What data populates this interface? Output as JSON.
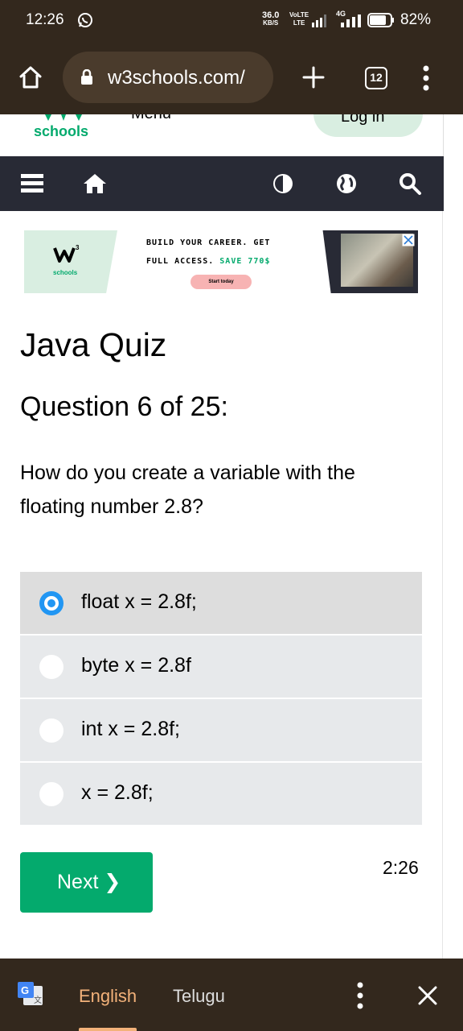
{
  "status_bar": {
    "time": "12:26",
    "speed_value": "36.0",
    "speed_unit": "KB/S",
    "volte_top": "VoLTE",
    "volte_bottom": "LTE",
    "network": "4G",
    "battery": "82%"
  },
  "browser": {
    "url": "w3schools.com/",
    "tab_count": "12"
  },
  "site": {
    "logo_word": "schools",
    "menu_label": "Menu",
    "login_label": "Log in"
  },
  "ad": {
    "logo_word": "schools",
    "line1": "BUILD YOUR CAREER. GET",
    "line2_prefix": "FULL ACCESS. ",
    "line2_save": "SAVE 770$",
    "button": "Start today"
  },
  "quiz": {
    "title": "Java Quiz",
    "question_number": "Question 6 of 25:",
    "question_text": "How do you create a variable with the floating number 2.8?",
    "options": [
      {
        "label": "float x = 2.8f;",
        "selected": true
      },
      {
        "label": "byte x = 2.8f",
        "selected": false
      },
      {
        "label": "int x = 2.8f;",
        "selected": false
      },
      {
        "label": "x = 2.8f;",
        "selected": false
      }
    ],
    "next_label": "Next ❯",
    "timer": "2:26"
  },
  "translate_bar": {
    "lang_source": "English",
    "lang_target": "Telugu"
  },
  "colors": {
    "brand_green": "#04aa6d",
    "chrome_brown": "#33281d",
    "nav_dark": "#282a35",
    "radio_blue": "#2196f3",
    "translate_accent": "#f3b27a"
  }
}
